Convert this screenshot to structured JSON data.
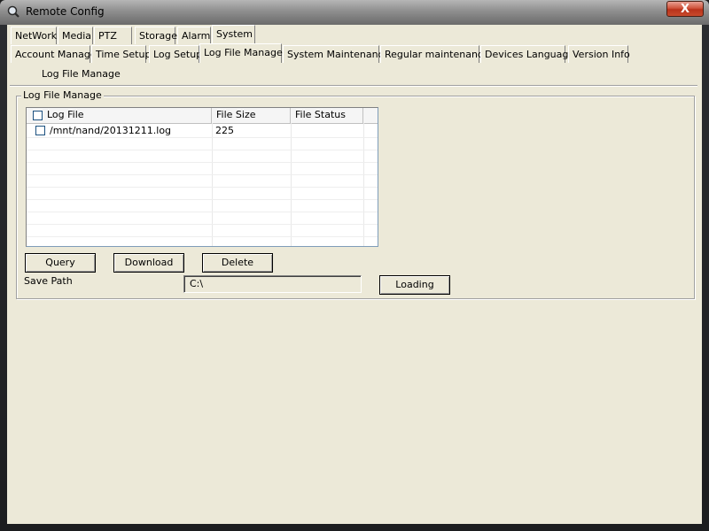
{
  "window": {
    "title": "Remote Config",
    "close_glyph": "X"
  },
  "tabs_main": [
    {
      "label": "NetWork",
      "active": false
    },
    {
      "label": "Media",
      "active": false
    },
    {
      "label": "PTZ",
      "active": false
    },
    {
      "label": "Storage",
      "active": false
    },
    {
      "label": "Alarm",
      "active": false
    },
    {
      "label": "System",
      "active": true
    }
  ],
  "tabs_sub": [
    {
      "label": "Account Manage",
      "active": false
    },
    {
      "label": "Time Setup",
      "active": false
    },
    {
      "label": "Log Setup",
      "active": false
    },
    {
      "label": "Log File Manage",
      "active": true
    },
    {
      "label": "System Maintenance",
      "active": false
    },
    {
      "label": "Regular maintenance",
      "active": false
    },
    {
      "label": "Devices Language",
      "active": false
    },
    {
      "label": "Version Info",
      "active": false
    }
  ],
  "section_title": "Log File Manage",
  "group_title": "Log File Manage",
  "log_table": {
    "columns": [
      "Log File",
      "File Size",
      "File Status"
    ],
    "rows": [
      {
        "checked": false,
        "file": "/mnt/nand/20131211.log",
        "size": "225",
        "status": ""
      }
    ]
  },
  "buttons": {
    "query": "Query",
    "download": "Download",
    "delete": "Delete",
    "loading": "Loading"
  },
  "save_path": {
    "label": "Save Path",
    "value": "C:\\"
  },
  "icons": {
    "app": "magnifier-icon",
    "close": "close-icon",
    "checkbox": "checkbox-icon"
  }
}
